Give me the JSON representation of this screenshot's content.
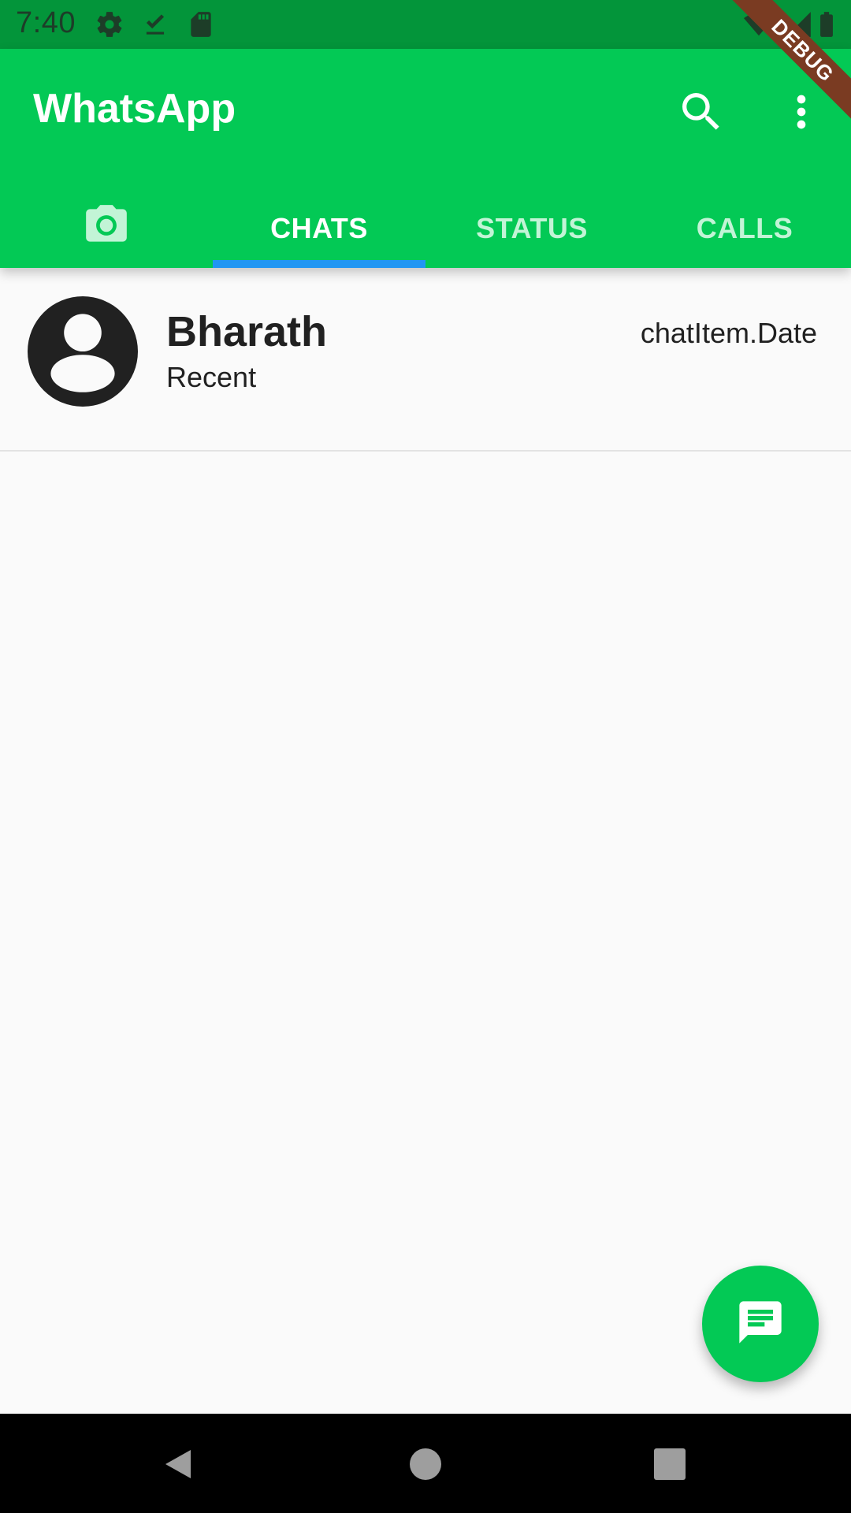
{
  "status_bar": {
    "time": "7:40",
    "icons": [
      "settings-icon",
      "download-done-icon",
      "sd-card-icon",
      "wifi-icon",
      "signal-icon",
      "battery-icon"
    ]
  },
  "debug_banner": "DEBUG",
  "app_bar": {
    "title": "WhatsApp",
    "actions": [
      "search-icon",
      "more-vert-icon"
    ],
    "tabs": [
      {
        "label": "",
        "icon": "camera-icon",
        "active": false
      },
      {
        "label": "CHATS",
        "active": true
      },
      {
        "label": "STATUS",
        "active": false
      },
      {
        "label": "CALLS",
        "active": false
      }
    ]
  },
  "chats": [
    {
      "name": "Bharath",
      "subtitle": "Recent",
      "date": "chatItem.Date",
      "avatar_icon": "account-circle-icon"
    }
  ],
  "fab": {
    "icon": "message-icon"
  },
  "nav_bar": {
    "buttons": [
      "back-icon",
      "home-icon",
      "recents-icon"
    ]
  },
  "colors": {
    "primary": "#03c955",
    "status_bar": "#03953a",
    "tab_indicator": "#2196f3",
    "debug_banner": "#7a3b22"
  }
}
